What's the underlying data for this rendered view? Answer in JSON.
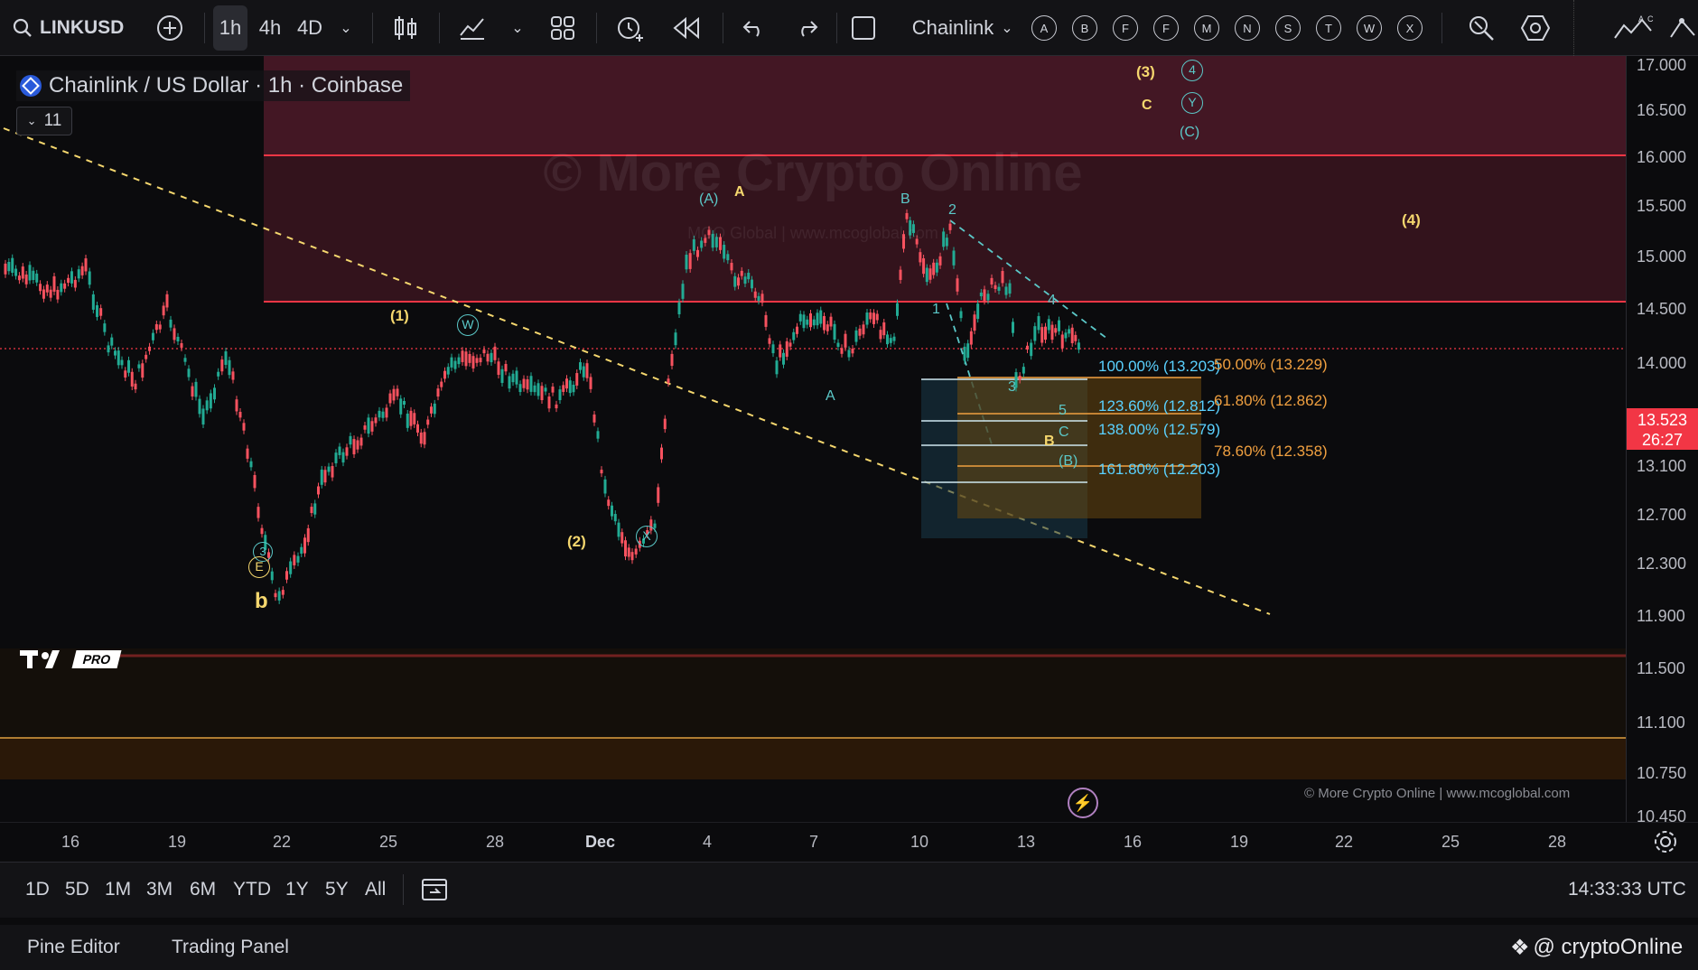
{
  "toolbar": {
    "symbol": "LINKUSD",
    "timeframes": [
      "1h",
      "4h",
      "4D"
    ],
    "active_timeframe": "1h",
    "layout_name": "Chainlink",
    "drawing_tools": [
      "A",
      "B",
      "F",
      "F",
      "M",
      "N",
      "S",
      "T",
      "W",
      "X"
    ]
  },
  "legend": {
    "title": "Chainlink / US Dollar · 1h · Coinbase",
    "indicator_count": "11"
  },
  "watermark": {
    "title": "© More Crypto Online",
    "subtitle": "MCO Global   |   www.mcoglobal.com",
    "footer": "© More Crypto Online   |   www.mcoglobal.com"
  },
  "price_axis": {
    "ticks": [
      "17.000",
      "16.500",
      "16.000",
      "15.500",
      "15.000",
      "14.500",
      "14.000",
      "13.100",
      "12.700",
      "12.300",
      "11.900",
      "11.500",
      "11.100",
      "10.750",
      "10.450"
    ],
    "last_price": "13.523",
    "countdown": "26:27"
  },
  "time_axis": {
    "ticks": [
      "16",
      "19",
      "22",
      "25",
      "28",
      "Dec",
      "4",
      "7",
      "10",
      "13",
      "16",
      "19",
      "22",
      "25",
      "28"
    ]
  },
  "fib_levels_blue": [
    "100.00% (13.203)",
    "123.60% (12.812)",
    "138.00% (12.579)",
    "161.80% (12.203)"
  ],
  "fib_levels_orange": [
    "50.00% (13.229)",
    "61.80% (12.862)",
    "78.60% (12.358)"
  ],
  "wave_labels": {
    "yellow": [
      "(3)",
      "C",
      "A",
      "(4)",
      "(1)",
      "(2)",
      "b",
      "B"
    ],
    "cyan": [
      "4",
      "Y",
      "(C)",
      "(A)",
      "B",
      "2",
      "1",
      "4",
      "W",
      "A",
      "3",
      "5",
      "C",
      "(B)",
      "X",
      "3"
    ],
    "circled_e": "E"
  },
  "range_bar": {
    "ranges": [
      "1D",
      "5D",
      "1M",
      "3M",
      "6M",
      "YTD",
      "1Y",
      "5Y",
      "All"
    ],
    "clock": "14:33:33 UTC"
  },
  "bottom_panel": {
    "tabs": [
      "Pine Editor",
      "Trading Panel"
    ],
    "brand": "@ cryptoOnline"
  },
  "logo": {
    "badge": "PRO"
  },
  "colors": {
    "resistance": "#f23645",
    "zone": "#5a1f2c",
    "fib_blue": "#5ad1ff",
    "fib_orange": "#f0a040",
    "wave_yellow": "#f5d76e",
    "wave_cyan": "#5bc8c8"
  }
}
